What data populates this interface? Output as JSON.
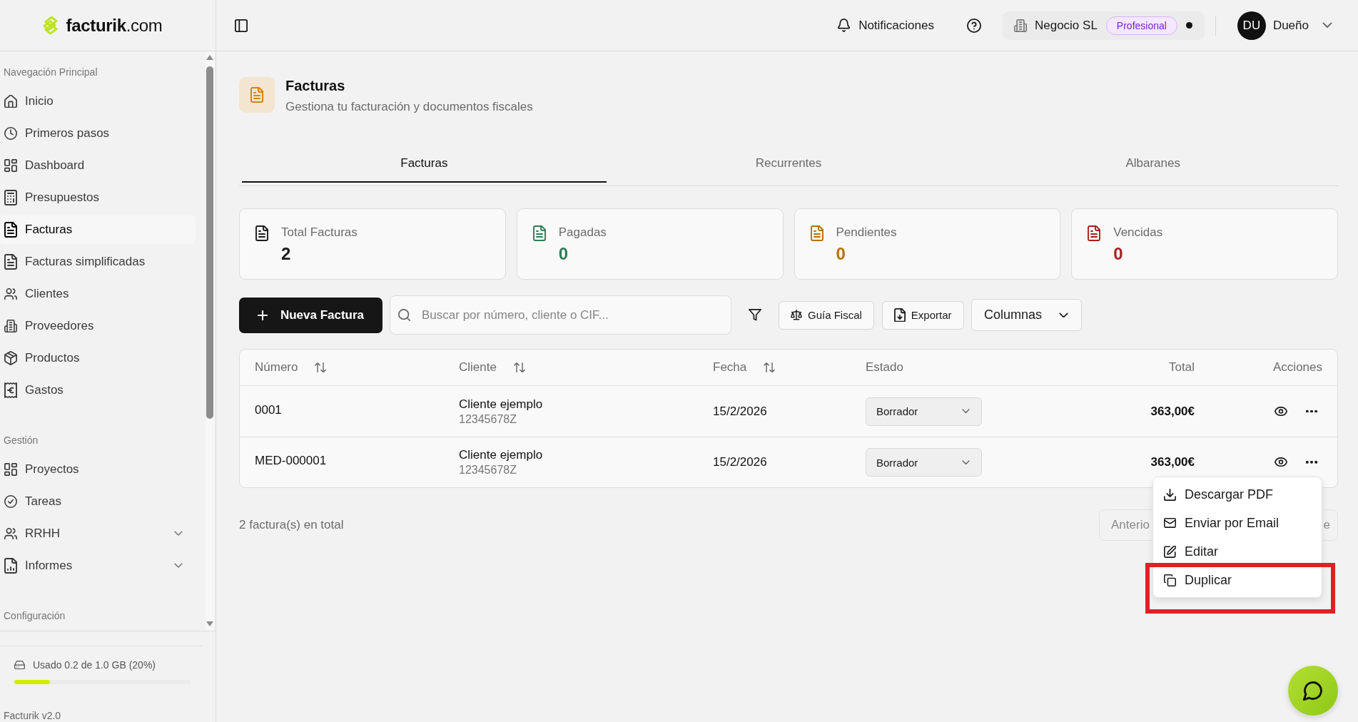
{
  "sidebar": {
    "logo": "**facturik**.com",
    "sections": [
      {
        "title": "Navegación Principal",
        "items": [
          {
            "label": "Inicio",
            "kind": "link",
            "selected": false
          },
          {
            "label": "Primeros pasos",
            "kind": "link",
            "selected": false
          },
          {
            "label": "Dashboard",
            "kind": "link",
            "selected": false
          },
          {
            "label": "Presupuestos",
            "kind": "link",
            "selected": false
          },
          {
            "label": "Facturas",
            "kind": "link",
            "selected": true
          },
          {
            "label": "Facturas simplificadas",
            "kind": "link",
            "selected": false
          },
          {
            "label": "Clientes",
            "kind": "link",
            "selected": false
          },
          {
            "label": "Proveedores",
            "kind": "link",
            "selected": false
          },
          {
            "label": "Productos",
            "kind": "link",
            "selected": false
          },
          {
            "label": "Gastos",
            "kind": "link",
            "selected": false
          }
        ]
      },
      {
        "title": "Gestión",
        "items": [
          {
            "label": "Proyectos",
            "kind": "link",
            "selected": false
          },
          {
            "label": "Tareas",
            "kind": "link",
            "selected": false
          },
          {
            "label": "RRHH",
            "kind": "group",
            "selected": false,
            "expanded": false
          },
          {
            "label": "Informes",
            "kind": "group",
            "selected": false,
            "expanded": false
          }
        ]
      },
      {
        "title": "Configuración"
      }
    ],
    "storage": {
      "label": "Usado 0.2 de 1.0 GB (20%)",
      "level": 0.2
    },
    "version": "Facturik v2.0"
  },
  "topbar": {
    "notifications": "Notificaciones",
    "company": {
      "name": "Negocio SL",
      "plan": "Profesional"
    },
    "user": {
      "initials": "DU",
      "name": "Dueño"
    }
  },
  "page": {
    "title": "Facturas",
    "subtitle": "Gestiona tu facturación y documentos fiscales"
  },
  "tabs": [
    {
      "label": "Facturas",
      "selected": true
    },
    {
      "label": "Recurrentes",
      "selected": false
    },
    {
      "label": "Albaranes",
      "selected": false
    }
  ],
  "stats": [
    {
      "label": "Total Facturas",
      "value": "2",
      "color": "#1c1c1c"
    },
    {
      "label": "Pagadas",
      "value": "0",
      "color": "#2f7d57"
    },
    {
      "label": "Pendientes",
      "value": "0",
      "color": "#b8700c"
    },
    {
      "label": "Vencidas",
      "value": "0",
      "color": "#a82020"
    }
  ],
  "toolbar": {
    "new_button": "Nueva Factura",
    "search": {
      "placeholder": "Buscar por número, cliente o CIF..."
    },
    "buttons": [
      "Guía Fiscal",
      "Exportar"
    ],
    "columns_button": "Columnas"
  },
  "table": {
    "columns": [
      {
        "label": "Número",
        "sortable": true
      },
      {
        "label": "Cliente",
        "sortable": true
      },
      {
        "label": "Fecha",
        "sortable": true
      },
      {
        "label": "Estado",
        "sortable": false
      },
      {
        "label": "Total",
        "sortable": false
      },
      {
        "label": "Acciones",
        "sortable": false
      }
    ],
    "rows": [
      {
        "number": "0001",
        "client": "Cliente ejemplo",
        "tax_id": "12345678Z",
        "date": "15/2/2026",
        "status": "Borrador",
        "total": "363,00€"
      },
      {
        "number": "MED-000001",
        "client": "Cliente ejemplo",
        "tax_id": "12345678Z",
        "date": "15/2/2026",
        "status": "Borrador",
        "total": "363,00€"
      }
    ]
  },
  "footer": {
    "count": "2 factura(s) en total",
    "pagination": {
      "previous": "Anterio",
      "next": "e"
    }
  },
  "action_menu": {
    "items": [
      {
        "label": "Descargar PDF",
        "highlighted": false
      },
      {
        "label": "Enviar por Email",
        "highlighted": false
      },
      {
        "label": "Editar",
        "highlighted": false
      },
      {
        "label": "Duplicar",
        "highlighted": true
      }
    ]
  }
}
